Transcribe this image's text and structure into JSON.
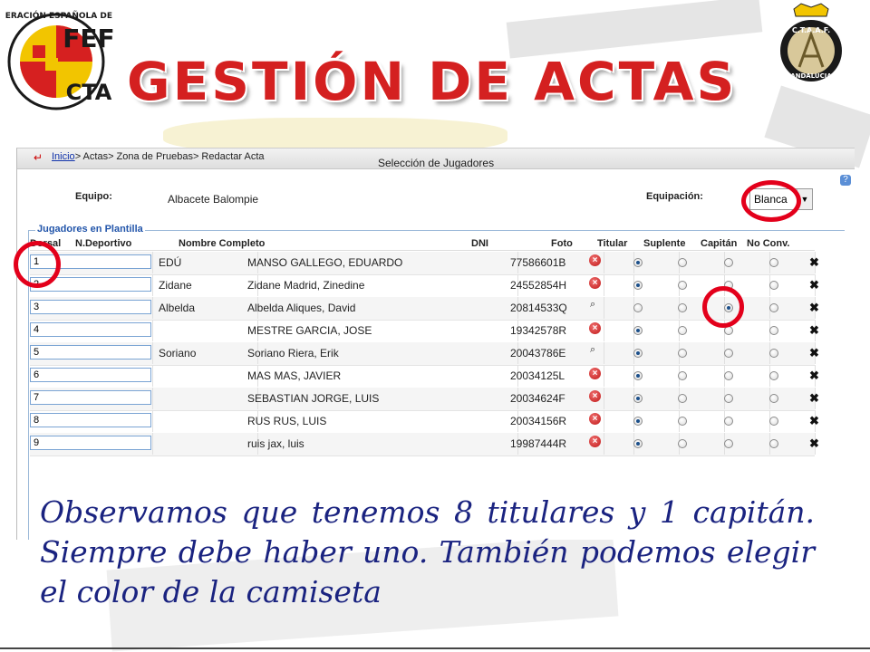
{
  "header": {
    "title": "GESTIÓN DE ACTAS",
    "rfef_logo_text": "FEF CTA",
    "rfef_logo_ring": "REAL FEDERACIÓN ESPAÑOLA DE FÚTBOL",
    "ctaaf_logo_text": "C.T.A.A.F.",
    "ctaaf_logo_sub": "ANDALUCIA"
  },
  "app": {
    "breadcrumb": {
      "home": "Inicio",
      "rest": "> Actas> Zona de Pruebas> Redactar Acta"
    },
    "page_heading": "Selección de Jugadores",
    "equipo_label": "Equipo:",
    "equipo_value": "Albacete Balompie",
    "equipacion_label": "Equipación:",
    "equipacion_value": "Blanca",
    "fieldset_legend": "Jugadores en Plantilla",
    "columns": {
      "dorsal": "Dorsal",
      "ndeportivo": "N.Deportivo",
      "nombre": "Nombre Completo",
      "dni": "DNI",
      "foto": "Foto",
      "titular": "Titular",
      "suplente": "Suplente",
      "capitan": "Capitán",
      "noconv": "No Conv."
    },
    "players": [
      {
        "dorsal": "1",
        "deportivo": "EDÚ",
        "nombre": "MANSO GALLEGO, EDUARDO",
        "dni": "77586601B",
        "foto": "missing",
        "status": "titular"
      },
      {
        "dorsal": "2",
        "deportivo": "Zidane",
        "nombre": "Zidane Madrid, Zinedine",
        "dni": "24552854H",
        "foto": "missing",
        "status": "titular"
      },
      {
        "dorsal": "3",
        "deportivo": "Albelda",
        "nombre": "Albelda Aliques, David",
        "dni": "20814533Q",
        "foto": "view",
        "status": "capitan"
      },
      {
        "dorsal": "4",
        "deportivo": "",
        "nombre": "MESTRE GARCIA, JOSE",
        "dni": "19342578R",
        "foto": "missing",
        "status": "titular"
      },
      {
        "dorsal": "5",
        "deportivo": "Soriano",
        "nombre": "Soriano Riera, Erik",
        "dni": "20043786E",
        "foto": "view",
        "status": "titular"
      },
      {
        "dorsal": "6",
        "deportivo": "",
        "nombre": "MAS MAS, JAVIER",
        "dni": "20034125L",
        "foto": "missing",
        "status": "titular"
      },
      {
        "dorsal": "7",
        "deportivo": "",
        "nombre": "SEBASTIAN JORGE, LUIS",
        "dni": "20034624F",
        "foto": "missing",
        "status": "titular"
      },
      {
        "dorsal": "8",
        "deportivo": "",
        "nombre": "RUS RUS, LUIS",
        "dni": "20034156R",
        "foto": "missing",
        "status": "titular"
      },
      {
        "dorsal": "9",
        "deportivo": "",
        "nombre": "ruis jax, luis",
        "dni": "19987444R",
        "foto": "missing",
        "status": "titular"
      }
    ]
  },
  "caption": "Observamos que tenemos 8 titulares y 1 capitán. Siempre debe haber uno. También podemos elegir el color de la camiseta",
  "colors": {
    "title_red": "#d42020",
    "annotation_red": "#e3001b",
    "caption_blue": "#1a2380"
  }
}
